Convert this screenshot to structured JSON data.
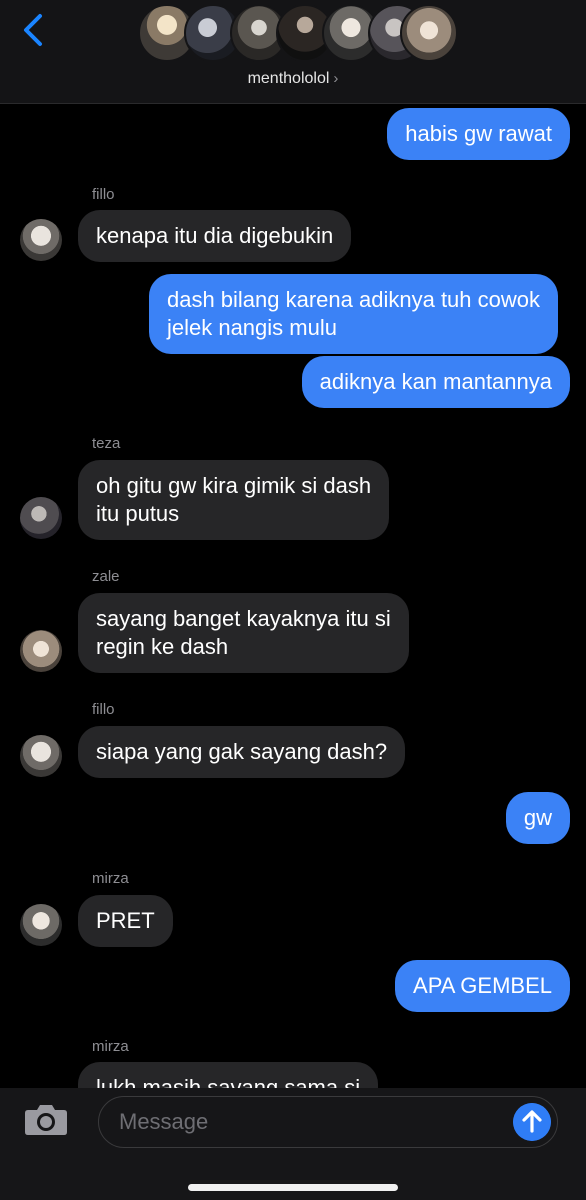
{
  "header": {
    "group_name": "menthololol",
    "chevron": "›",
    "back_icon": "chevron-left-icon",
    "accent": "#1a84ff"
  },
  "messages": [
    {
      "type": "out",
      "text": "habis gw rawat"
    },
    {
      "type": "sender",
      "text": "fillo"
    },
    {
      "type": "in",
      "text": "kenapa itu dia digebukin"
    },
    {
      "type": "out",
      "lines": [
        "dash bilang karena adiknya tuh cowok",
        "jelek nangis mulu"
      ]
    },
    {
      "type": "out",
      "text": "adiknya kan mantannya"
    },
    {
      "type": "sender",
      "text": "teza"
    },
    {
      "type": "in",
      "lines": [
        "oh gitu gw kira gimik si dash",
        "itu putus"
      ]
    },
    {
      "type": "sender",
      "text": "zale"
    },
    {
      "type": "in",
      "lines": [
        "sayang banget kayaknya itu si",
        "regin ke dash"
      ]
    },
    {
      "type": "sender",
      "text": "fillo"
    },
    {
      "type": "in",
      "text": "siapa yang gak sayang dash?"
    },
    {
      "type": "out",
      "text": "gw"
    },
    {
      "type": "sender",
      "text": "mirza"
    },
    {
      "type": "in",
      "text": "PRET"
    },
    {
      "type": "out",
      "text": "APA GEMBEL"
    },
    {
      "type": "sender",
      "text": "mirza"
    },
    {
      "type": "in",
      "text": "lukh masih sayang sama si"
    }
  ],
  "composer": {
    "placeholder": "Message",
    "camera_icon": "camera-icon",
    "send_icon": "send-arrow-up-icon"
  },
  "colors": {
    "outgoing_bubble": "#3b82f6",
    "incoming_bubble": "#262628",
    "background": "#000000"
  }
}
